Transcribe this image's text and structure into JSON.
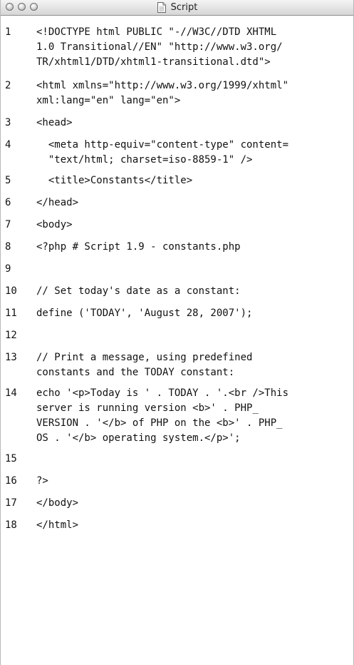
{
  "window": {
    "title": "Script",
    "title_icon": "document-icon",
    "buttons": [
      "close-button",
      "minimize-button",
      "zoom-button"
    ]
  },
  "code": {
    "lines": [
      {
        "n": "1",
        "wrapped": [
          "<!DOCTYPE html PUBLIC \"-//W3C//DTD XHTML",
          "1.0 Transitional//EN\" \"http://www.w3.org/",
          "TR/xhtml1/DTD/xhtml1-transitional.dtd\">"
        ]
      },
      {
        "n": "2",
        "wrapped": [
          "<html xmlns=\"http://www.w3.org/1999/xhtml\"",
          "xml:lang=\"en\" lang=\"en\">"
        ]
      },
      {
        "n": "3",
        "wrapped": [
          "<head>"
        ]
      },
      {
        "n": "4",
        "wrapped": [
          "  <meta http-equiv=\"content-type\" content=",
          "  \"text/html; charset=iso-8859-1\" />"
        ]
      },
      {
        "n": "5",
        "wrapped": [
          "  <title>Constants</title>"
        ]
      },
      {
        "n": "6",
        "wrapped": [
          "</head>"
        ]
      },
      {
        "n": "7",
        "wrapped": [
          "<body>"
        ]
      },
      {
        "n": "8",
        "wrapped": [
          "<?php # Script 1.9 - constants.php"
        ]
      },
      {
        "n": "9",
        "wrapped": [
          ""
        ]
      },
      {
        "n": "10",
        "wrapped": [
          "// Set today's date as a constant:"
        ]
      },
      {
        "n": "11",
        "wrapped": [
          "define ('TODAY', 'August 28, 2007');"
        ]
      },
      {
        "n": "12",
        "wrapped": [
          ""
        ]
      },
      {
        "n": "13",
        "wrapped": [
          "// Print a message, using predefined",
          "constants and the TODAY constant:"
        ]
      },
      {
        "n": "14",
        "wrapped": [
          "echo '<p>Today is ' . TODAY . '.<br />This",
          "server is running version <b>' . PHP_",
          "VERSION . '</b> of PHP on the <b>' . PHP_",
          "OS . '</b> operating system.</p>';"
        ]
      },
      {
        "n": "15",
        "wrapped": [
          ""
        ]
      },
      {
        "n": "16",
        "wrapped": [
          "?>"
        ]
      },
      {
        "n": "17",
        "wrapped": [
          "</body>"
        ]
      },
      {
        "n": "18",
        "wrapped": [
          "</html>"
        ]
      }
    ]
  }
}
